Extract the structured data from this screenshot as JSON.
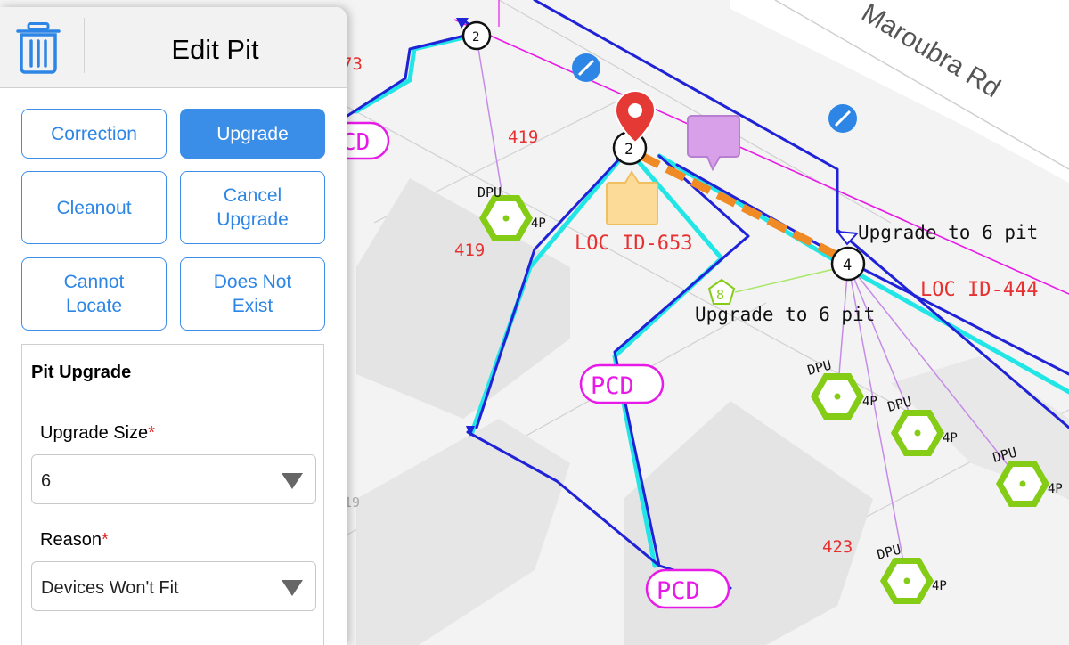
{
  "panel": {
    "title": "Edit Pit",
    "buttons": [
      {
        "label": "Correction",
        "active": false
      },
      {
        "label": "Upgrade",
        "active": true
      },
      {
        "label": "Cleanout",
        "active": false
      },
      {
        "label": "Cancel\nUpgrade",
        "active": false
      },
      {
        "label": "Cannot\nLocate",
        "active": false
      },
      {
        "label": "Does Not\nExist",
        "active": false
      }
    ],
    "section_title": "Pit Upgrade",
    "upgrade_size": {
      "label": "Upgrade Size",
      "required_mark": "*",
      "value": "6"
    },
    "reason": {
      "label": "Reason",
      "required_mark": "*",
      "value": "Devices Won't Fit"
    }
  },
  "map": {
    "road_name": "Maroubra Rd",
    "lot_numbers": [
      "73",
      "419",
      "419",
      "423",
      "19"
    ],
    "loc_ids": [
      "LOC ID-653",
      "LOC ID-444"
    ],
    "annotations": [
      "Upgrade to 6 pit",
      "Upgrade to 6 pit"
    ],
    "pcd_labels": [
      "CD",
      "PCD",
      "PCD"
    ],
    "pit_numbers": [
      "2",
      "2",
      "4"
    ],
    "dpu_label": "DPU",
    "port_label": "4P",
    "pentagon_label": "8",
    "colors": {
      "selected_route": "#f08a24",
      "conduit": "#1f22d6",
      "cable": "#22e6e6",
      "pcd": "#e81ae8",
      "dpu": "#84cc16",
      "marker": "#e53935",
      "lot_text": "#e83030"
    }
  }
}
